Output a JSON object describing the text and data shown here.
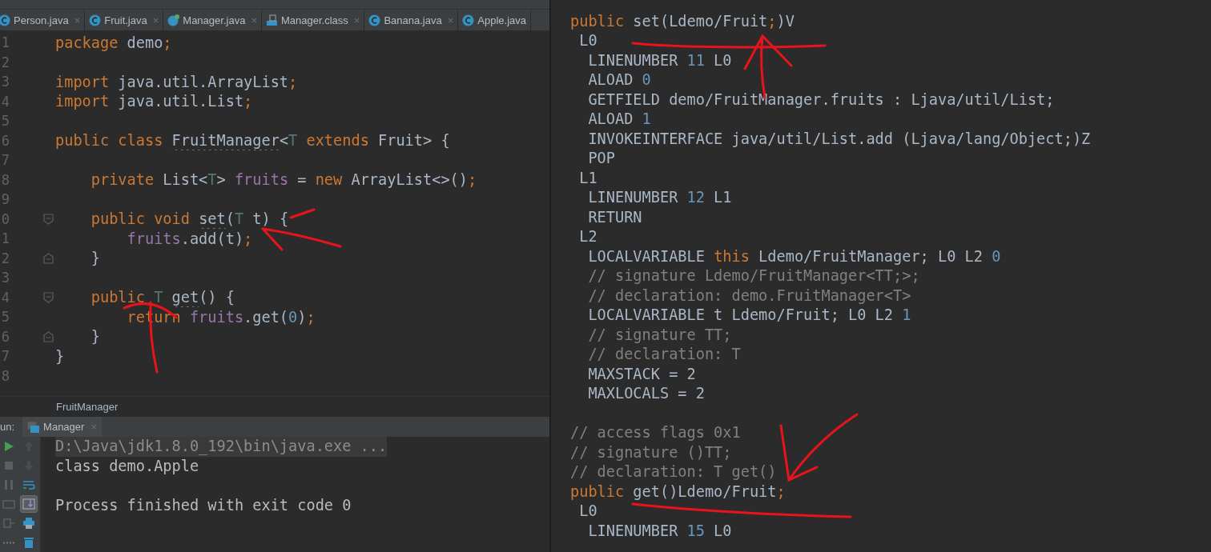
{
  "editor_tabs": [
    {
      "label": "Person.java",
      "kind": "java",
      "close": "×"
    },
    {
      "label": "Fruit.java",
      "kind": "java",
      "close": "×"
    },
    {
      "label": "Manager.java",
      "kind": "runnable",
      "close": "×"
    },
    {
      "label": "Manager.class",
      "kind": "class",
      "close": "×"
    },
    {
      "label": "Banana.java",
      "kind": "java",
      "close": "×"
    },
    {
      "label": "Apple.java",
      "kind": "java"
    }
  ],
  "source": {
    "lines": [
      {
        "number": "1",
        "kind": "plain",
        "tokens": [
          {
            "kind": "kw",
            "text": "package"
          },
          {
            "kind": "plain",
            "text": " demo"
          },
          {
            "kind": "kw",
            "text": ";"
          }
        ]
      },
      {
        "number": "2",
        "kind": "plain"
      },
      {
        "number": "3",
        "kind": "plain",
        "tokens": [
          {
            "kind": "kw",
            "text": "import"
          },
          {
            "kind": "plain",
            "text": " java.util.ArrayList"
          },
          {
            "kind": "kw",
            "text": ";"
          }
        ]
      },
      {
        "number": "4",
        "kind": "plain",
        "tokens": [
          {
            "kind": "kw",
            "text": "import"
          },
          {
            "kind": "plain",
            "text": " java.util.List"
          },
          {
            "kind": "kw",
            "text": ";"
          }
        ]
      },
      {
        "number": "5",
        "kind": "plain"
      },
      {
        "number": "6",
        "kind": "plain",
        "tokens": [
          {
            "kind": "kw",
            "text": "public class "
          },
          {
            "kind": "warned",
            "text": "FruitManager"
          },
          {
            "kind": "plain",
            "text": "<"
          },
          {
            "kind": "tparam",
            "text": "T"
          },
          {
            "kind": "kw",
            "text": " extends"
          },
          {
            "kind": "plain",
            "text": " Fruit> {"
          }
        ]
      },
      {
        "number": "7",
        "kind": "plain"
      },
      {
        "number": "8",
        "kind": "plain",
        "tokens": [
          {
            "kind": "kw",
            "text": "    private"
          },
          {
            "kind": "plain",
            "text": " List<"
          },
          {
            "kind": "tparam",
            "text": "T"
          },
          {
            "kind": "plain",
            "text": "> "
          },
          {
            "kind": "field",
            "text": "fruits"
          },
          {
            "kind": "plain",
            "text": " = "
          },
          {
            "kind": "kw",
            "text": "new"
          },
          {
            "kind": "plain",
            "text": " ArrayList<>()"
          },
          {
            "kind": "kw",
            "text": ";"
          }
        ]
      },
      {
        "number": "9",
        "kind": "plain"
      },
      {
        "number": "0",
        "kind": "fold_start",
        "tokens": [
          {
            "kind": "kw",
            "text": "    public void "
          },
          {
            "kind": "warned",
            "text": "set"
          },
          {
            "kind": "plain",
            "text": "("
          },
          {
            "kind": "tparam",
            "text": "T"
          },
          {
            "kind": "plain",
            "text": " t) {"
          }
        ]
      },
      {
        "number": "1",
        "kind": "plain",
        "tokens": [
          {
            "kind": "field",
            "text": "        fruits"
          },
          {
            "kind": "plain",
            "text": ".add(t)"
          },
          {
            "kind": "kw",
            "text": ";"
          }
        ]
      },
      {
        "number": "2",
        "kind": "fold_end",
        "tokens": [
          {
            "kind": "plain",
            "text": "    }"
          }
        ]
      },
      {
        "number": "3",
        "kind": "plain"
      },
      {
        "number": "4",
        "kind": "fold_start",
        "tokens": [
          {
            "kind": "kw",
            "text": "    public "
          },
          {
            "kind": "tparam",
            "text": "T "
          },
          {
            "kind": "warned",
            "text": "get"
          },
          {
            "kind": "plain",
            "text": "() {"
          }
        ]
      },
      {
        "number": "5",
        "kind": "plain",
        "tokens": [
          {
            "kind": "kw",
            "text": "        return "
          },
          {
            "kind": "field",
            "text": "fruits"
          },
          {
            "kind": "plain",
            "text": ".get("
          },
          {
            "kind": "num",
            "text": "0"
          },
          {
            "kind": "plain",
            "text": ")"
          },
          {
            "kind": "kw",
            "text": ";"
          }
        ]
      },
      {
        "number": "6",
        "kind": "fold_end",
        "tokens": [
          {
            "kind": "plain",
            "text": "    }"
          }
        ]
      },
      {
        "number": "7",
        "kind": "plain",
        "tokens": [
          {
            "kind": "plain",
            "text": "}"
          }
        ]
      },
      {
        "number": "8",
        "kind": "plain"
      }
    ],
    "breadcrumb": "FruitManager"
  },
  "run_panel": {
    "label": "un:",
    "tab": {
      "label": "Manager",
      "close": "×"
    },
    "tools": [
      {
        "kind": "run",
        "selected": false
      },
      {
        "kind": "up",
        "selected": false
      },
      {
        "kind": "stop",
        "selected": false
      },
      {
        "kind": "down",
        "selected": false
      },
      {
        "kind": "pause",
        "selected": false
      },
      {
        "kind": "wrap",
        "selected": false
      },
      {
        "kind": "dump",
        "selected": false
      },
      {
        "kind": "scroll",
        "selected": true
      },
      {
        "kind": "exit",
        "selected": false
      },
      {
        "kind": "print",
        "selected": false
      },
      {
        "kind": "layout",
        "selected": false
      },
      {
        "kind": "trash",
        "selected": false
      }
    ],
    "console": {
      "command": "D:\\Java\\jdk1.8.0_192\\bin\\java.exe ...",
      "output": [
        "class demo.Apple"
      ],
      "exit_message": "Process finished with exit code 0"
    }
  },
  "bytecode": {
    "blocks": [
      {
        "lines": [
          {
            "tokens": [
              {
                "kind": "kw",
                "text": "public"
              },
              {
                "kind": "plain",
                "text": " set(Ldemo/Fruit"
              },
              {
                "kind": "kw",
                "text": ";"
              },
              {
                "kind": "plain",
                "text": ")V"
              }
            ]
          },
          {
            "tokens": [
              {
                "kind": "plain",
                "text": " L0"
              }
            ]
          },
          {
            "tokens": [
              {
                "kind": "plain",
                "text": "  LINENUMBER "
              },
              {
                "kind": "num",
                "text": "11"
              },
              {
                "kind": "plain",
                "text": " L0"
              }
            ]
          },
          {
            "tokens": [
              {
                "kind": "plain",
                "text": "  ALOAD "
              },
              {
                "kind": "num",
                "text": "0"
              }
            ]
          },
          {
            "tokens": [
              {
                "kind": "plain",
                "text": "  GETFIELD demo/FruitManager.fruits : Ljava/util/List;"
              }
            ]
          },
          {
            "tokens": [
              {
                "kind": "plain",
                "text": "  ALOAD "
              },
              {
                "kind": "num",
                "text": "1"
              }
            ]
          },
          {
            "tokens": [
              {
                "kind": "plain",
                "text": "  INVOKEINTERFACE java/util/List.add (Ljava/lang/Object;)Z"
              }
            ]
          },
          {
            "tokens": [
              {
                "kind": "plain",
                "text": "  POP"
              }
            ]
          },
          {
            "tokens": [
              {
                "kind": "plain",
                "text": " L1"
              }
            ]
          },
          {
            "tokens": [
              {
                "kind": "plain",
                "text": "  LINENUMBER "
              },
              {
                "kind": "num",
                "text": "12"
              },
              {
                "kind": "plain",
                "text": " L1"
              }
            ]
          },
          {
            "tokens": [
              {
                "kind": "plain",
                "text": "  RETURN"
              }
            ]
          },
          {
            "tokens": [
              {
                "kind": "plain",
                "text": " L2"
              }
            ]
          },
          {
            "tokens": [
              {
                "kind": "plain",
                "text": "  LOCALVARIABLE "
              },
              {
                "kind": "kw",
                "text": "this"
              },
              {
                "kind": "plain",
                "text": " Ldemo/FruitManager; L0 L2 "
              },
              {
                "kind": "num",
                "text": "0"
              }
            ]
          },
          {
            "tokens": [
              {
                "kind": "comment",
                "text": "  // signature Ldemo/FruitManager<TT;>;"
              }
            ]
          },
          {
            "tokens": [
              {
                "kind": "comment",
                "text": "  // declaration: demo.FruitManager<T>"
              }
            ]
          },
          {
            "tokens": [
              {
                "kind": "plain",
                "text": "  LOCALVARIABLE t Ldemo/Fruit; L0 L2 "
              },
              {
                "kind": "num",
                "text": "1"
              }
            ]
          },
          {
            "tokens": [
              {
                "kind": "comment",
                "text": "  // signature TT;"
              }
            ]
          },
          {
            "tokens": [
              {
                "kind": "comment",
                "text": "  // declaration: T"
              }
            ]
          },
          {
            "tokens": [
              {
                "kind": "plain",
                "text": "  MAXSTACK = 2"
              }
            ]
          },
          {
            "tokens": [
              {
                "kind": "plain",
                "text": "  MAXLOCALS = 2"
              }
            ]
          }
        ]
      },
      {
        "lines": [
          {
            "tokens": [
              {
                "kind": "comment",
                "text": "// access flags 0x1"
              }
            ]
          },
          {
            "tokens": [
              {
                "kind": "comment",
                "text": "// signature ()TT;"
              }
            ]
          },
          {
            "tokens": [
              {
                "kind": "comment",
                "text": "// declaration: T get()"
              }
            ]
          },
          {
            "tokens": [
              {
                "kind": "kw",
                "text": "public"
              },
              {
                "kind": "plain",
                "text": " get()Ldemo/Fruit"
              },
              {
                "kind": "kw",
                "text": ";"
              }
            ]
          },
          {
            "tokens": [
              {
                "kind": "plain",
                "text": " L0"
              }
            ]
          },
          {
            "tokens": [
              {
                "kind": "plain",
                "text": "  LINENUMBER "
              },
              {
                "kind": "num",
                "text": "15"
              },
              {
                "kind": "plain",
                "text": " L0"
              }
            ]
          }
        ]
      }
    ]
  }
}
